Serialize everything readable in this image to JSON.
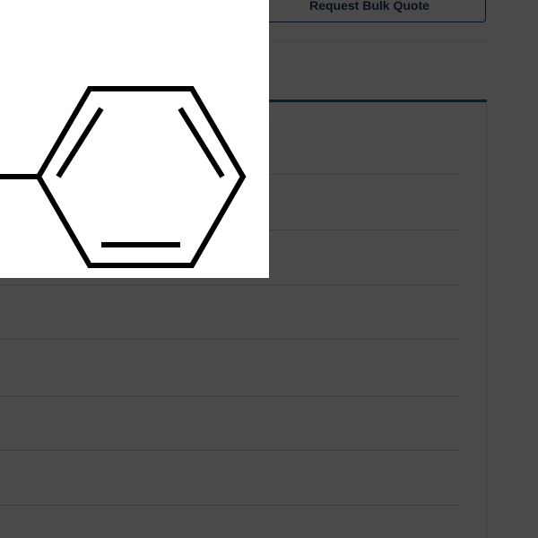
{
  "product": {
    "bulk_quote_label": "Request Bulk Quote"
  },
  "table": {
    "row_count": 7
  },
  "modal": {
    "image_subject": "benzene-ring-structure"
  }
}
